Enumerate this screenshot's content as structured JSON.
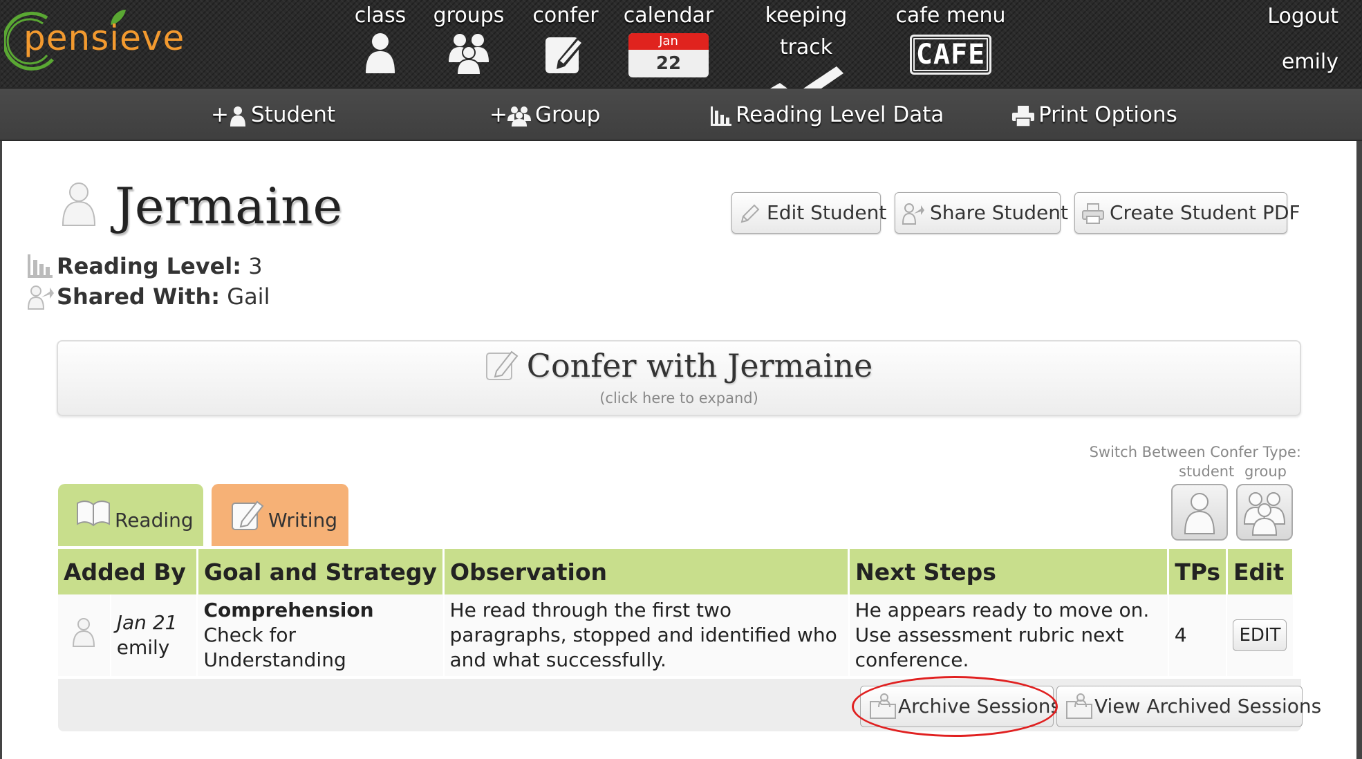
{
  "app": {
    "logo_text": "pensieve"
  },
  "topnav": {
    "items": [
      {
        "label": "class",
        "icon": "person-icon"
      },
      {
        "label": "groups",
        "icon": "group-icon"
      },
      {
        "label": "confer",
        "icon": "pencil-note-icon"
      },
      {
        "label": "calendar",
        "icon": "calendar-icon",
        "month": "Jan",
        "day": "22"
      },
      {
        "label": "keeping track",
        "icon": "checkmark-icon"
      },
      {
        "label": "cafe menu",
        "icon": "cafe-sign-icon",
        "sign_text": "CAFE"
      }
    ],
    "logout_label": "Logout",
    "username": "emily"
  },
  "subnav": {
    "items": [
      {
        "label": "Student",
        "prefix": "+"
      },
      {
        "label": "Group",
        "prefix": "+"
      },
      {
        "label": "Reading Level Data"
      },
      {
        "label": "Print Options"
      }
    ]
  },
  "student": {
    "name": "Jermaine",
    "reading_level_label": "Reading Level:",
    "reading_level": "3",
    "shared_with_label": "Shared With:",
    "shared_with": "Gail"
  },
  "actions": {
    "edit_student": "Edit Student",
    "share_student": "Share Student",
    "create_pdf": "Create Student PDF"
  },
  "confer": {
    "title": "Confer with Jermaine",
    "hint": "(click here to expand)"
  },
  "switch": {
    "label": "Switch Between Confer Type:",
    "student": "student",
    "group": "group"
  },
  "tabs": [
    {
      "label": "Reading",
      "color": "#c8de8c"
    },
    {
      "label": "Writing",
      "color": "#f6b176"
    }
  ],
  "table": {
    "headers": [
      "Added By",
      "Goal and Strategy",
      "Observation",
      "Next Steps",
      "TPs",
      "Edit"
    ],
    "rows": [
      {
        "date": "Jan 21",
        "added_by": "emily",
        "goal": "Comprehension",
        "strategy": "Check for Understanding",
        "observation": "He read through the first two paragraphs, stopped and identified who and what successfully.",
        "next_steps": "He appears ready to move on. Use assessment rubric next conference.",
        "tps": "4",
        "edit_label": "EDIT"
      }
    ],
    "archive_label": "Archive Sessions",
    "view_archived_label": "View Archived Sessions"
  },
  "colors": {
    "reading_green": "#c8de8c",
    "writing_orange": "#f6b176",
    "logo_orange": "#f39a2f",
    "logo_green": "#5aa833",
    "highlight_red": "#e02020"
  }
}
